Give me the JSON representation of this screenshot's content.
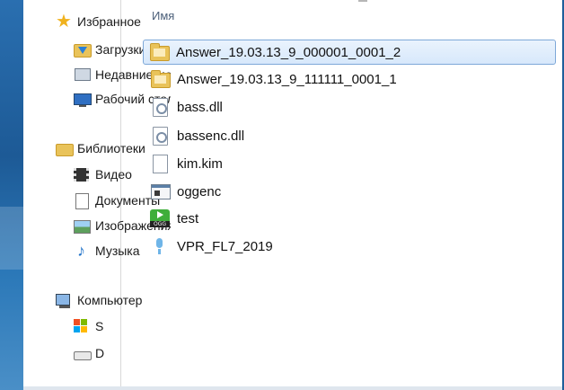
{
  "nav": {
    "items": [
      {
        "label": "Избранное",
        "icon": "star-icon"
      },
      {
        "label": "Загрузки",
        "icon": "downloads-icon"
      },
      {
        "label": "Недавние места",
        "icon": "recent-places-icon"
      },
      {
        "label": "Рабочий стол",
        "icon": "desktop-icon"
      },
      {
        "label": "Библиотеки",
        "icon": "libraries-icon"
      },
      {
        "label": "Видео",
        "icon": "video-icon"
      },
      {
        "label": "Документы",
        "icon": "documents-icon"
      },
      {
        "label": "Изображения",
        "icon": "pictures-icon"
      },
      {
        "label": "Музыка",
        "icon": "music-icon"
      },
      {
        "label": "Компьютер",
        "icon": "computer-icon"
      },
      {
        "label": "S",
        "icon": "system-drive-icon"
      },
      {
        "label": "D",
        "icon": "drive-icon"
      }
    ]
  },
  "files": {
    "column_header": "Имя",
    "rows": [
      {
        "name": "Answer_19.03.13_9_000001_0001_2",
        "icon": "folder-icon",
        "selected": true
      },
      {
        "name": "Answer_19.03.13_9_111111_0001_1",
        "icon": "folder-icon",
        "selected": false
      },
      {
        "name": "bass.dll",
        "icon": "dll-file-icon",
        "selected": false
      },
      {
        "name": "bassenc.dll",
        "icon": "dll-file-icon",
        "selected": false
      },
      {
        "name": "kim.kim",
        "icon": "blank-file-icon",
        "selected": false
      },
      {
        "name": "oggenc",
        "icon": "application-icon",
        "selected": false
      },
      {
        "name": "test",
        "icon": "ogg-file-icon",
        "selected": false
      },
      {
        "name": "VPR_FL7_2019",
        "icon": "audio-file-icon",
        "selected": false
      }
    ]
  },
  "colors": {
    "selection_bg": "#d7e8fb",
    "selection_border": "#7ea8d8",
    "header_text": "#4c607a",
    "desktop_blue": "#1f5f9a"
  }
}
